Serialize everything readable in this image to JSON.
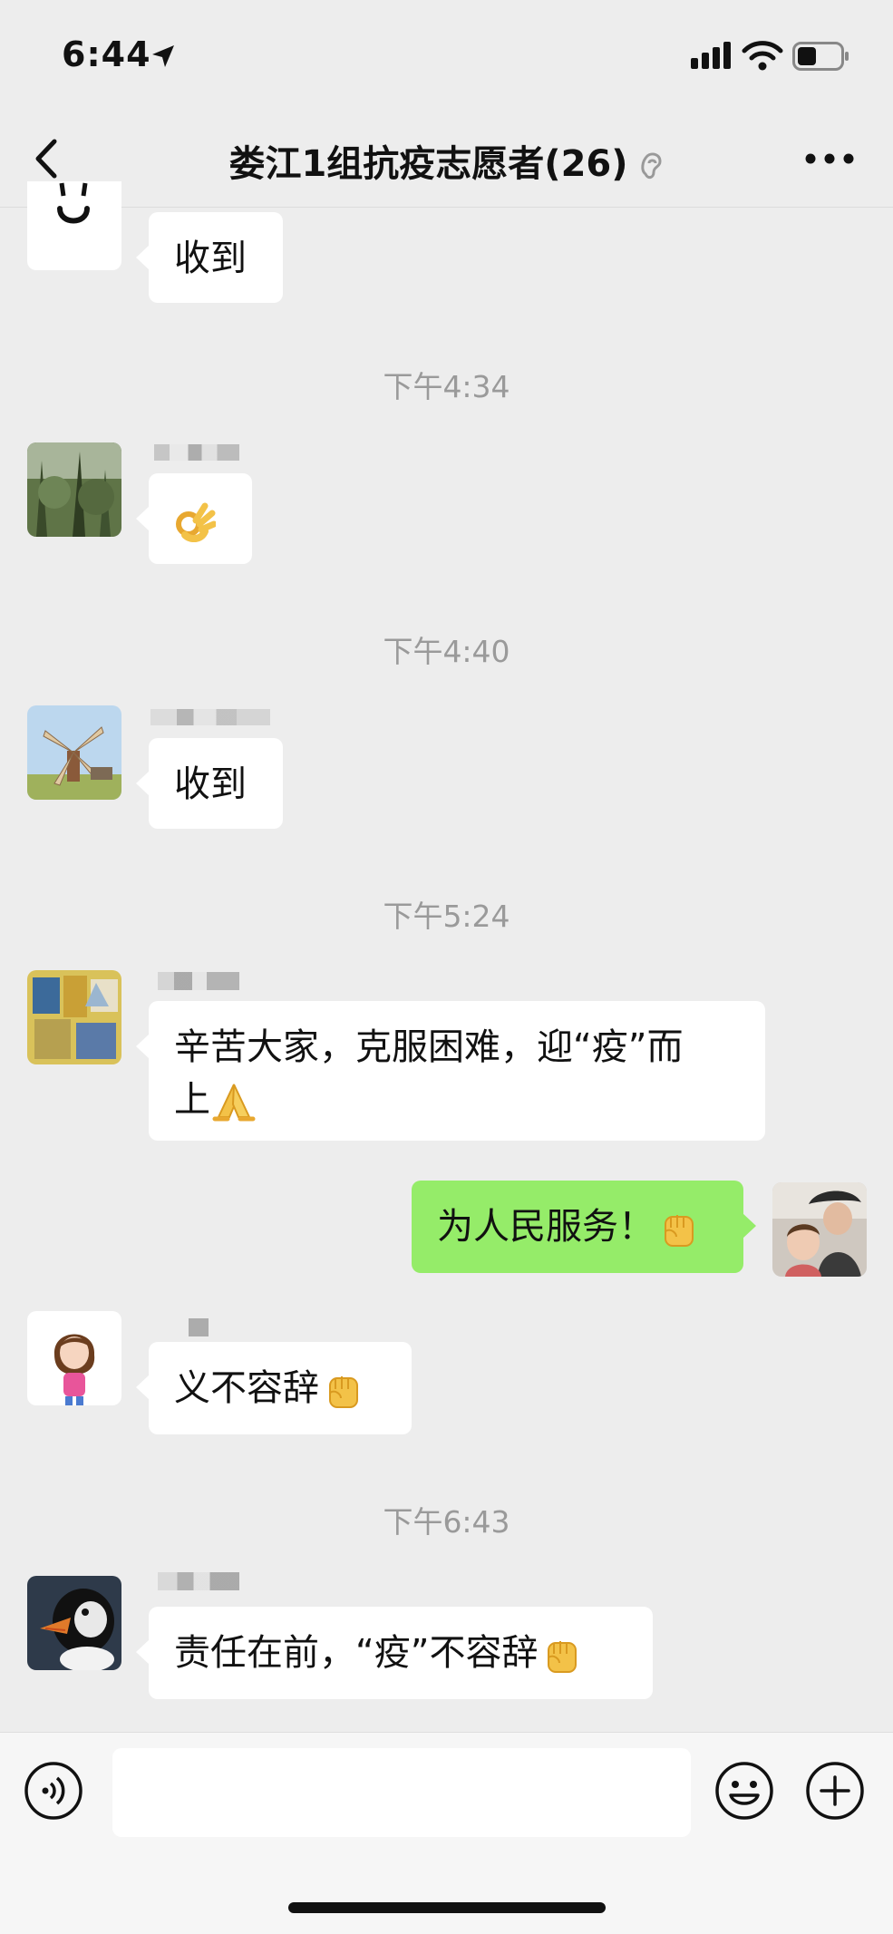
{
  "status_bar": {
    "time": "6:44"
  },
  "header": {
    "title": "娄江1组抗疫志愿者(26)"
  },
  "messages": [
    {
      "type": "bubble",
      "side": "left",
      "text": "收到"
    },
    {
      "type": "time",
      "text": "下午4:34"
    },
    {
      "type": "bubble",
      "side": "left",
      "text": "",
      "emoji": "ok-hand"
    },
    {
      "type": "time",
      "text": "下午4:40"
    },
    {
      "type": "bubble",
      "side": "left",
      "text": "收到"
    },
    {
      "type": "time",
      "text": "下午5:24"
    },
    {
      "type": "bubble",
      "side": "left",
      "text_line1": "辛苦大家，克服困难，迎“疫”而",
      "text_line2": "上",
      "emoji": "folded-hands"
    },
    {
      "type": "bubble",
      "side": "right",
      "text": "为人民服务！",
      "emoji": "raised-fist"
    },
    {
      "type": "bubble",
      "side": "left",
      "text": "义不容辞",
      "emoji": "raised-fist"
    },
    {
      "type": "time",
      "text": "下午6:43"
    },
    {
      "type": "bubble",
      "side": "left",
      "text": "责任在前，“疫”不容辞",
      "emoji": "raised-fist"
    }
  ],
  "colors": {
    "background": "#ededed",
    "own_bubble": "#95ec69",
    "other_bubble": "#ffffff",
    "timestamp": "#9a9a9a"
  },
  "icons": [
    "back-arrow-icon",
    "earpiece-mute-icon",
    "more-icon",
    "voice-icon",
    "emoji-icon",
    "plus-icon",
    "ok-hand-emoji",
    "folded-hands-emoji",
    "raised-fist-emoji"
  ]
}
